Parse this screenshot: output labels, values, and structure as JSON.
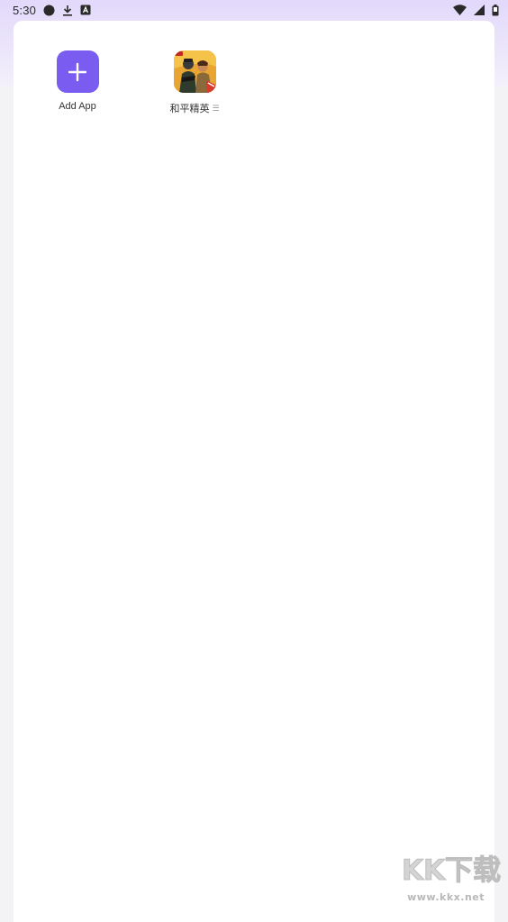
{
  "status_bar": {
    "time": "5:30",
    "left_icons": [
      "circle-icon",
      "download-icon",
      "a-badge-icon"
    ],
    "right_icons": [
      "wifi-icon",
      "signal-icon",
      "battery-icon"
    ]
  },
  "apps": [
    {
      "label": "Add App",
      "icon": "plus-icon",
      "color": "#7b5cf0"
    },
    {
      "label": "和平精英",
      "suffix": "☰",
      "icon": "game-icon"
    }
  ],
  "watermark": {
    "logo": "KK下载",
    "url": "www.kkx.net"
  },
  "colors": {
    "accent": "#7b5cf0",
    "header_gradient_top": "#e2d9fb",
    "page_bg": "#f3f3f5",
    "card_bg": "#ffffff"
  }
}
